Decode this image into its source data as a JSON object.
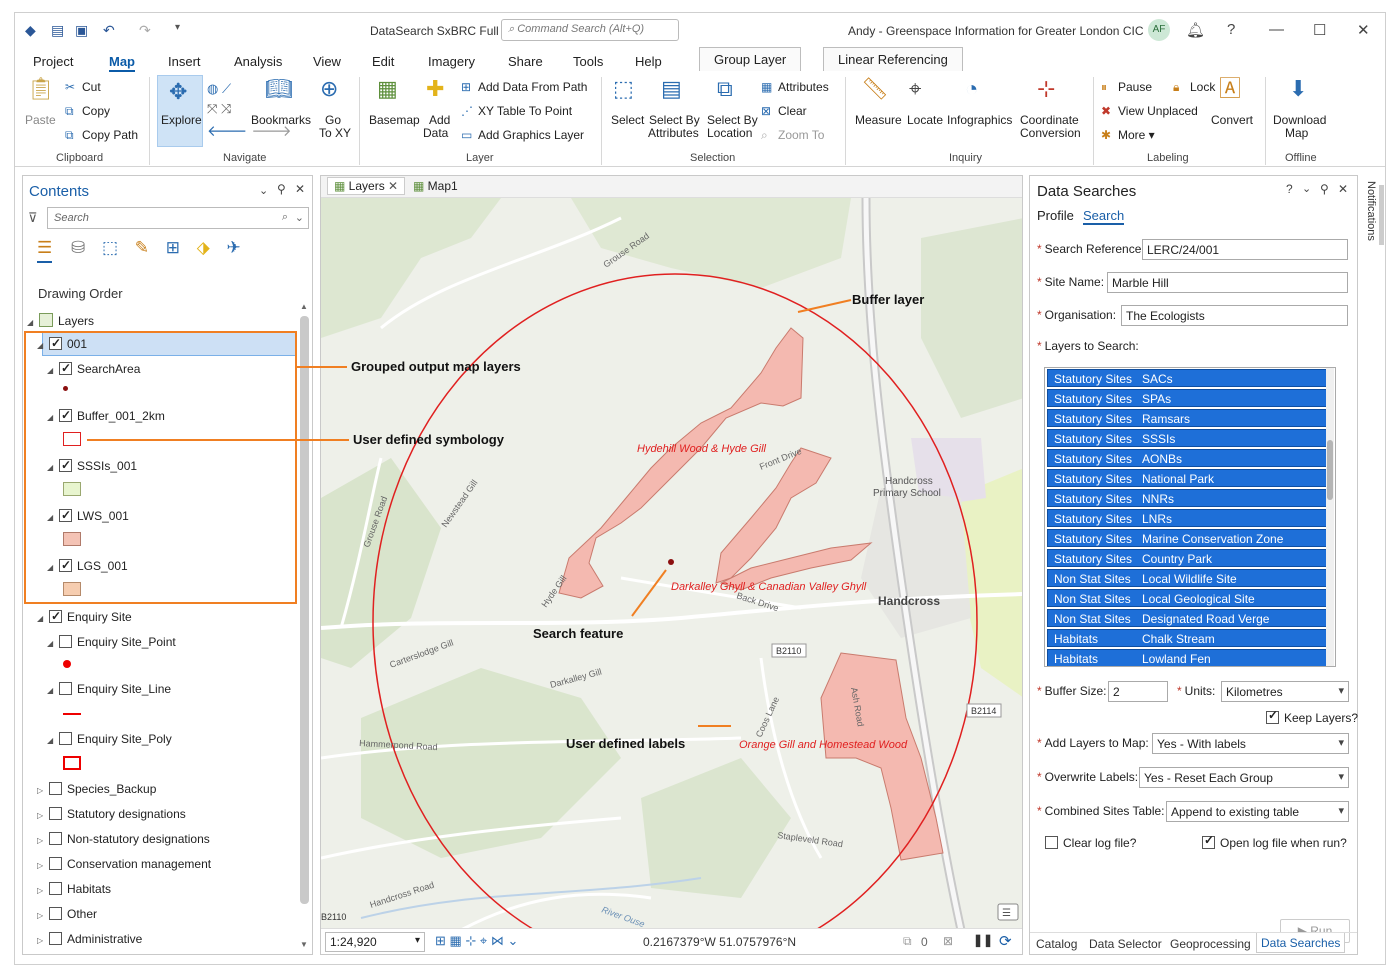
{
  "title_bar": {
    "app_title": "DataSearch SxBRC Full",
    "command_search_placeholder": "Command Search (Alt+Q)",
    "user": "Andy - Greenspace Information for Greater London CIC",
    "avatar_initials": "AF"
  },
  "ribbon_tabs": [
    "Project",
    "Map",
    "Insert",
    "Analysis",
    "View",
    "Edit",
    "Imagery",
    "Share",
    "Tools",
    "Help"
  ],
  "active_tab": "Map",
  "contextual_tabs": [
    "Group Layer",
    "Linear Referencing"
  ],
  "ribbon": {
    "clipboard": {
      "paste": "Paste",
      "cut": "Cut",
      "copy": "Copy",
      "copy_path": "Copy Path",
      "label": "Clipboard"
    },
    "navigate": {
      "explore": "Explore",
      "bookmarks": "Bookmarks",
      "go_to_xy_1": "Go",
      "go_to_xy_2": "To XY",
      "label": "Navigate"
    },
    "layer": {
      "basemap": "Basemap",
      "add_data_1": "Add",
      "add_data_2": "Data",
      "add_from_path": "Add Data From Path",
      "xy_table": "XY Table To Point",
      "add_graphics": "Add Graphics Layer",
      "label": "Layer"
    },
    "selection": {
      "select": "Select",
      "select_by_attr_1": "Select By",
      "select_by_attr_2": "Attributes",
      "select_by_loc_1": "Select By",
      "select_by_loc_2": "Location",
      "attributes": "Attributes",
      "clear": "Clear",
      "zoom_to": "Zoom To",
      "label": "Selection"
    },
    "inquiry": {
      "measure": "Measure",
      "locate": "Locate",
      "infographics": "Infographics",
      "coord_1": "Coordinate",
      "coord_2": "Conversion",
      "label": "Inquiry"
    },
    "labeling": {
      "pause": "Pause",
      "lock": "Lock",
      "view_unplaced": "View Unplaced",
      "more": "More",
      "convert": "Convert",
      "label": "Labeling"
    },
    "offline": {
      "download_1": "Download",
      "download_2": "Map",
      "label": "Offline"
    }
  },
  "contents": {
    "title": "Contents",
    "search_placeholder": "Search",
    "drawing_order": "Drawing Order",
    "tree": [
      {
        "label": "Layers",
        "checked": null
      },
      {
        "label": "001",
        "checked": true
      },
      {
        "label": "SearchArea",
        "checked": true
      },
      {
        "label": "Buffer_001_2km",
        "checked": true
      },
      {
        "label": "SSSIs_001",
        "checked": true
      },
      {
        "label": "LWS_001",
        "checked": true
      },
      {
        "label": "LGS_001",
        "checked": true
      },
      {
        "label": "Enquiry Site",
        "checked": true
      },
      {
        "label": "Enquiry Site_Point",
        "checked": false
      },
      {
        "label": "Enquiry Site_Line",
        "checked": false
      },
      {
        "label": "Enquiry Site_Poly",
        "checked": false
      },
      {
        "label": "Species_Backup",
        "checked": false
      },
      {
        "label": "Statutory designations",
        "checked": false
      },
      {
        "label": "Non-statutory designations",
        "checked": false
      },
      {
        "label": "Conservation management",
        "checked": false
      },
      {
        "label": "Habitats",
        "checked": false
      },
      {
        "label": "Other",
        "checked": false
      },
      {
        "label": "Administrative",
        "checked": false
      }
    ]
  },
  "annotations": {
    "grouped": "Grouped output map layers",
    "symbology": "User defined symbology",
    "buffer": "Buffer layer",
    "search_feature": "Search feature",
    "labels": "User defined labels"
  },
  "map": {
    "tabs": [
      "Layers",
      "Map1"
    ],
    "scale": "1:24,920",
    "coordinates": "0.2167379°W 51.0757976°N",
    "selected_count": "0",
    "site_labels": [
      "Hydehill Wood & Hyde Gill",
      "Darkalley Ghyll & Canadian Valley Ghyll",
      "Orange Gill and Homestead Wood"
    ],
    "place_labels": {
      "town": "Handcross",
      "school_1": "Handcross",
      "school_2": "Primary School",
      "b2110": "B2110",
      "b2114": "B2114",
      "b2110_corner": "B2110",
      "grouse_road": "Grouse Road",
      "grouse_road_2": "Grouse Road",
      "front_drive": "Front Drive",
      "back_drive": "Back Drive",
      "newstead_gill": "Newstead Gill",
      "hyde_gill": "Hyde Gill",
      "darkalley_gill": "Darkalley Gill",
      "carterslodge_gill": "Carterslodge Gill",
      "hammerpond_road": "Hammerpond Road",
      "coos_lane": "Coos Lane",
      "stapleveld_road": "Stapleveld Road",
      "handcross_road": "Handcross Road",
      "river_ouse": "River Ouse",
      "ash_road": "Ash Road"
    }
  },
  "data_searches": {
    "title": "Data Searches",
    "tabs": [
      "Profile",
      "Search"
    ],
    "active_tab": "Search",
    "search_reference_label": "Search Reference:",
    "search_reference": "LERC/24/001",
    "site_name_label": "Site Name:",
    "site_name": "Marble Hill",
    "organisation_label": "Organisation:",
    "organisation": "The Ecologists",
    "layers_label": "Layers to Search:",
    "layers": [
      {
        "category": "Statutory Sites",
        "name": "SACs"
      },
      {
        "category": "Statutory Sites",
        "name": "SPAs"
      },
      {
        "category": "Statutory Sites",
        "name": "Ramsars"
      },
      {
        "category": "Statutory Sites",
        "name": "SSSIs"
      },
      {
        "category": "Statutory Sites",
        "name": "AONBs"
      },
      {
        "category": "Statutory Sites",
        "name": "National Park"
      },
      {
        "category": "Statutory Sites",
        "name": "NNRs"
      },
      {
        "category": "Statutory Sites",
        "name": "LNRs"
      },
      {
        "category": "Statutory Sites",
        "name": "Marine Conservation Zone"
      },
      {
        "category": "Statutory Sites",
        "name": "Country Park"
      },
      {
        "category": "Non Stat Sites",
        "name": "Local Wildlife Site"
      },
      {
        "category": "Non Stat Sites",
        "name": "Local Geological Site"
      },
      {
        "category": "Non Stat Sites",
        "name": "Designated Road Verge"
      },
      {
        "category": "Habitats",
        "name": "Chalk Stream"
      },
      {
        "category": "Habitats",
        "name": "Lowland Fen"
      }
    ],
    "buffer_size_label": "Buffer Size:",
    "buffer_size": "2",
    "units_label": "Units:",
    "units": "Kilometres",
    "keep_layers": "Keep Layers?",
    "add_layers_label": "Add Layers to Map:",
    "add_layers": "Yes - With labels",
    "overwrite_labels_label": "Overwrite Labels:",
    "overwrite_labels": "Yes - Reset Each Group",
    "combined_sites_label": "Combined Sites Table:",
    "combined_sites": "Append to existing table",
    "clear_log": "Clear log file?",
    "open_log": "Open log file when run?",
    "run": "Run"
  },
  "bottom_tabs": [
    "Catalog",
    "Data Selector",
    "Geoprocessing",
    "Data Searches"
  ],
  "notifications": "Notifications",
  "colors": {
    "accent": "#0b5ba8",
    "selection_blue": "#1e6fd8",
    "annotation_orange": "#f07f22",
    "buffer_red": "#e02020",
    "site_fill": "#f4b9b0"
  }
}
